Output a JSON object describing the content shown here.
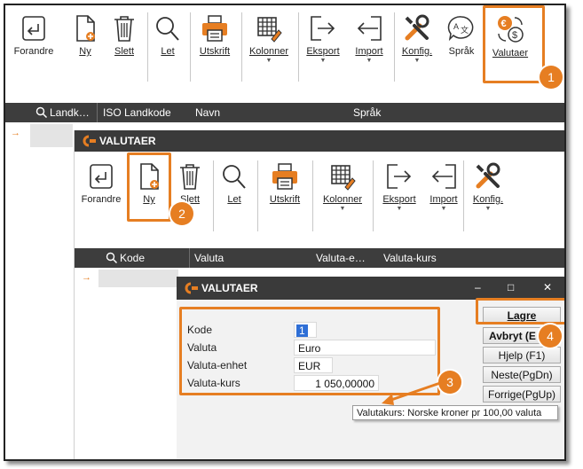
{
  "main_toolbar": {
    "items": [
      {
        "label": "Forandre",
        "icon": "edit-icon"
      },
      {
        "label": "Ny",
        "icon": "new-doc-icon"
      },
      {
        "label": "Slett",
        "icon": "trash-icon"
      },
      {
        "label": "Let",
        "icon": "search-icon"
      },
      {
        "label": "Utskrift",
        "icon": "printer-icon"
      },
      {
        "label": "Kolonner",
        "icon": "columns-icon"
      },
      {
        "label": "Eksport",
        "icon": "export-icon"
      },
      {
        "label": "Import",
        "icon": "import-icon"
      },
      {
        "label": "Konfig.",
        "icon": "tools-icon"
      },
      {
        "label": "Språk",
        "icon": "language-icon"
      },
      {
        "label": "Valutaer",
        "icon": "currency-icon"
      }
    ]
  },
  "main_grid": {
    "columns": [
      "Landk…",
      "ISO Landkode",
      "Navn",
      "Språk"
    ]
  },
  "currencies_window": {
    "title": "VALUTAER",
    "toolbar": {
      "items": [
        {
          "label": "Forandre",
          "icon": "edit-icon"
        },
        {
          "label": "Ny",
          "icon": "new-doc-icon"
        },
        {
          "label": "Slett",
          "icon": "trash-icon"
        },
        {
          "label": "Let",
          "icon": "search-icon"
        },
        {
          "label": "Utskrift",
          "icon": "printer-icon"
        },
        {
          "label": "Kolonner",
          "icon": "columns-icon"
        },
        {
          "label": "Eksport",
          "icon": "export-icon"
        },
        {
          "label": "Import",
          "icon": "import-icon"
        },
        {
          "label": "Konfig.",
          "icon": "tools-icon"
        }
      ]
    },
    "grid": {
      "columns": [
        "Kode",
        "Valuta",
        "Valuta-e…",
        "Valuta-kurs"
      ]
    }
  },
  "edit_dialog": {
    "title": "VALUTAER",
    "controls": {
      "minimize": "–",
      "maximize": "□",
      "close": "✕"
    },
    "fields": [
      {
        "label": "Kode",
        "value": "1"
      },
      {
        "label": "Valuta",
        "value": "Euro"
      },
      {
        "label": "Valuta-enhet",
        "value": "EUR"
      },
      {
        "label": "Valuta-kurs",
        "value": "1 050,00000"
      }
    ],
    "buttons": {
      "save": "Lagre",
      "cancel": "Avbryt (E",
      "help": "Hjelp (F1)",
      "next": "Neste(PgDn)",
      "prev": "Forrige(PgUp)"
    },
    "tooltip": "Valutakurs: Norske kroner pr 100,00 valuta"
  },
  "callouts": [
    "1",
    "2",
    "3",
    "4"
  ],
  "colors": {
    "accent": "#e67e22",
    "header": "#3d3d3d",
    "title_bar": "#3a3a3a"
  }
}
